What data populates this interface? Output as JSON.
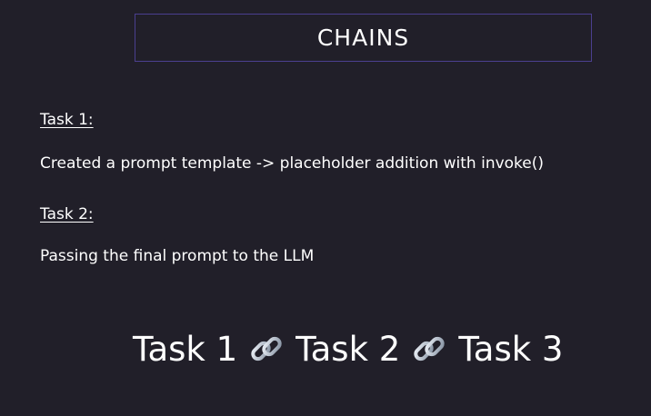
{
  "slide": {
    "title": "CHAINS",
    "tasks": [
      {
        "heading": "Task 1:",
        "description": "Created a prompt template -> placeholder addition with invoke()"
      },
      {
        "heading": "Task 2:",
        "description": "Passing the final prompt to the LLM"
      }
    ],
    "chain": [
      "Task 1",
      "Task 2",
      "Task 3"
    ],
    "connector_icon": "link-icon"
  },
  "colors": {
    "background": "#211f29",
    "title_border": "#4b3f8f",
    "text": "#ffffff"
  }
}
